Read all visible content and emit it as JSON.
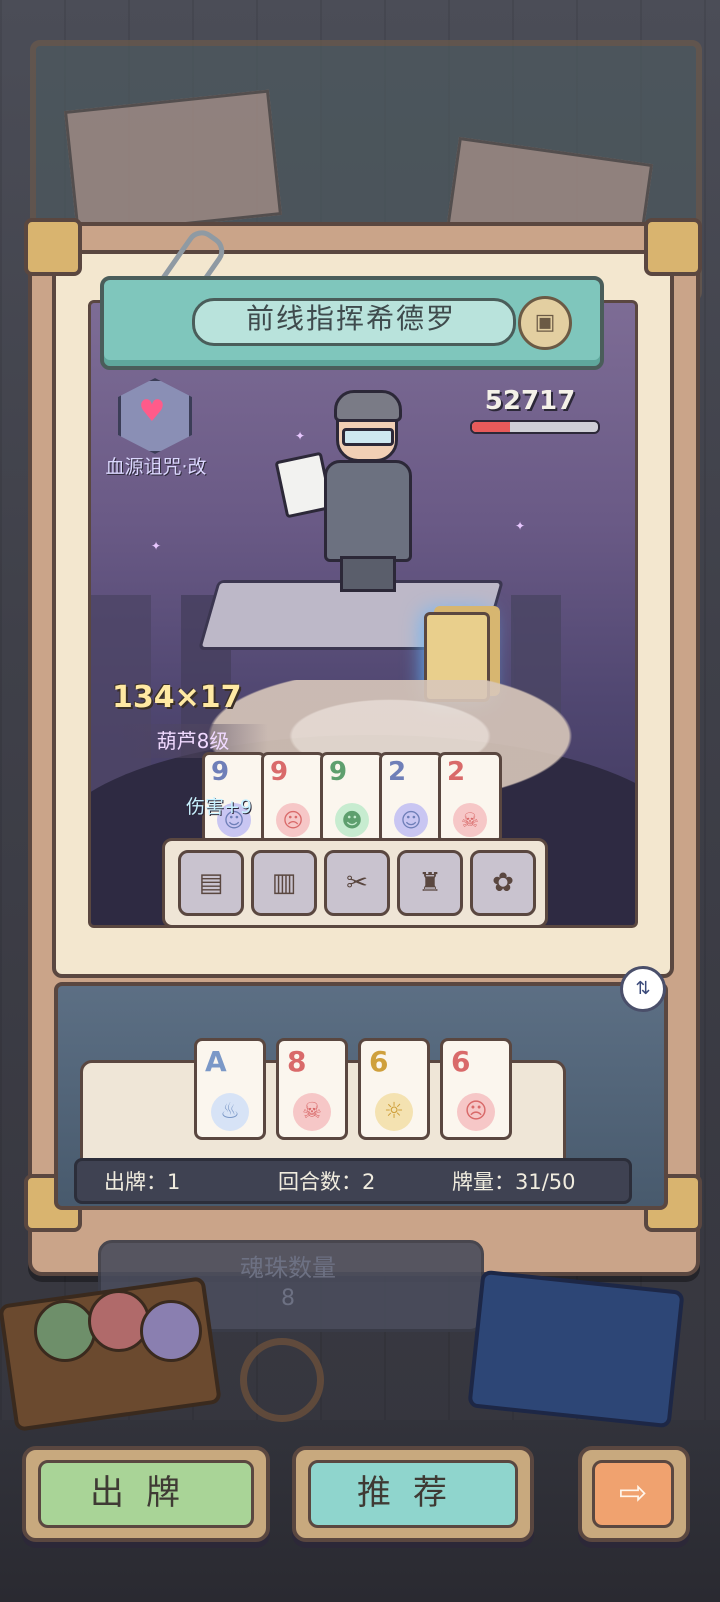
{
  "boss": {
    "name": "前线指挥希德罗",
    "hp_value": "52717",
    "hp_fraction": 0.3
  },
  "curse": {
    "label": "血源诅咒·改"
  },
  "score": {
    "formula": "134×17",
    "hand_label": "葫芦8级",
    "damage_label": "伤害+9"
  },
  "played_cards": [
    {
      "rank": "9",
      "color": "#6f7fb8",
      "face_bg": "#c9c6f2",
      "icon": "robot-face-icon",
      "glyph": "☺"
    },
    {
      "rank": "9",
      "color": "#d96a6a",
      "face_bg": "#f6c7c7",
      "icon": "devil-face-icon",
      "glyph": "☹"
    },
    {
      "rank": "9",
      "color": "#5e9f6e",
      "face_bg": "#c7ecd0",
      "icon": "monster-face-icon",
      "glyph": "☻"
    },
    {
      "rank": "2",
      "color": "#6f7fb8",
      "face_bg": "#c9c6f2",
      "icon": "robot-face-icon",
      "glyph": "☺"
    },
    {
      "rank": "2",
      "color": "#d96a6a",
      "face_bg": "#f6c7c7",
      "icon": "skull-face-icon",
      "glyph": "☠"
    }
  ],
  "jokers": [
    {
      "icon": "book-icon",
      "glyph": "▤"
    },
    {
      "icon": "card-icon",
      "glyph": "▥"
    },
    {
      "icon": "bone-icon",
      "glyph": "✂"
    },
    {
      "icon": "samurai-helmet-icon",
      "glyph": "♜"
    },
    {
      "icon": "snail-icon",
      "glyph": "✿"
    }
  ],
  "hand_cards": [
    {
      "rank": "A",
      "color": "#7b98c7",
      "face_bg": "#d7e3f6",
      "icon": "dragon-face-icon",
      "glyph": "♨"
    },
    {
      "rank": "8",
      "color": "#d96a6a",
      "face_bg": "#f6c7c7",
      "icon": "skull-arm-icon",
      "glyph": "☠"
    },
    {
      "rank": "6",
      "color": "#cfa03c",
      "face_bg": "#f4e2b1",
      "icon": "angel-face-icon",
      "glyph": "☼"
    },
    {
      "rank": "6",
      "color": "#d96a6a",
      "face_bg": "#f6c7c7",
      "icon": "devil-face-icon",
      "glyph": "☹"
    }
  ],
  "status": {
    "plays": "出牌：1",
    "rounds": "回合数：2",
    "deck": "牌量：31/50"
  },
  "soul": {
    "label": "魂珠数量",
    "count": "8"
  },
  "buttons": {
    "play": "出牌",
    "recommend": "推荐",
    "next": "⇨"
  }
}
